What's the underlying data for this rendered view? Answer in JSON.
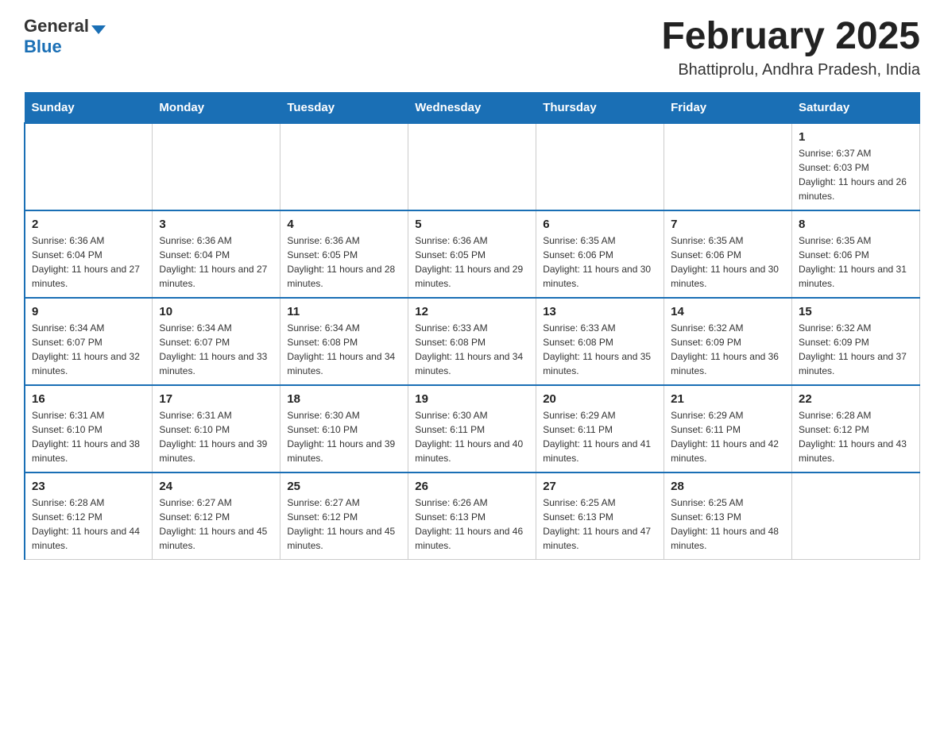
{
  "header": {
    "logo_general": "General",
    "logo_blue": "Blue",
    "month_title": "February 2025",
    "location": "Bhattiprolu, Andhra Pradesh, India"
  },
  "days_of_week": [
    "Sunday",
    "Monday",
    "Tuesday",
    "Wednesday",
    "Thursday",
    "Friday",
    "Saturday"
  ],
  "weeks": [
    [
      {
        "day": "",
        "info": ""
      },
      {
        "day": "",
        "info": ""
      },
      {
        "day": "",
        "info": ""
      },
      {
        "day": "",
        "info": ""
      },
      {
        "day": "",
        "info": ""
      },
      {
        "day": "",
        "info": ""
      },
      {
        "day": "1",
        "info": "Sunrise: 6:37 AM\nSunset: 6:03 PM\nDaylight: 11 hours and 26 minutes."
      }
    ],
    [
      {
        "day": "2",
        "info": "Sunrise: 6:36 AM\nSunset: 6:04 PM\nDaylight: 11 hours and 27 minutes."
      },
      {
        "day": "3",
        "info": "Sunrise: 6:36 AM\nSunset: 6:04 PM\nDaylight: 11 hours and 27 minutes."
      },
      {
        "day": "4",
        "info": "Sunrise: 6:36 AM\nSunset: 6:05 PM\nDaylight: 11 hours and 28 minutes."
      },
      {
        "day": "5",
        "info": "Sunrise: 6:36 AM\nSunset: 6:05 PM\nDaylight: 11 hours and 29 minutes."
      },
      {
        "day": "6",
        "info": "Sunrise: 6:35 AM\nSunset: 6:06 PM\nDaylight: 11 hours and 30 minutes."
      },
      {
        "day": "7",
        "info": "Sunrise: 6:35 AM\nSunset: 6:06 PM\nDaylight: 11 hours and 30 minutes."
      },
      {
        "day": "8",
        "info": "Sunrise: 6:35 AM\nSunset: 6:06 PM\nDaylight: 11 hours and 31 minutes."
      }
    ],
    [
      {
        "day": "9",
        "info": "Sunrise: 6:34 AM\nSunset: 6:07 PM\nDaylight: 11 hours and 32 minutes."
      },
      {
        "day": "10",
        "info": "Sunrise: 6:34 AM\nSunset: 6:07 PM\nDaylight: 11 hours and 33 minutes."
      },
      {
        "day": "11",
        "info": "Sunrise: 6:34 AM\nSunset: 6:08 PM\nDaylight: 11 hours and 34 minutes."
      },
      {
        "day": "12",
        "info": "Sunrise: 6:33 AM\nSunset: 6:08 PM\nDaylight: 11 hours and 34 minutes."
      },
      {
        "day": "13",
        "info": "Sunrise: 6:33 AM\nSunset: 6:08 PM\nDaylight: 11 hours and 35 minutes."
      },
      {
        "day": "14",
        "info": "Sunrise: 6:32 AM\nSunset: 6:09 PM\nDaylight: 11 hours and 36 minutes."
      },
      {
        "day": "15",
        "info": "Sunrise: 6:32 AM\nSunset: 6:09 PM\nDaylight: 11 hours and 37 minutes."
      }
    ],
    [
      {
        "day": "16",
        "info": "Sunrise: 6:31 AM\nSunset: 6:10 PM\nDaylight: 11 hours and 38 minutes."
      },
      {
        "day": "17",
        "info": "Sunrise: 6:31 AM\nSunset: 6:10 PM\nDaylight: 11 hours and 39 minutes."
      },
      {
        "day": "18",
        "info": "Sunrise: 6:30 AM\nSunset: 6:10 PM\nDaylight: 11 hours and 39 minutes."
      },
      {
        "day": "19",
        "info": "Sunrise: 6:30 AM\nSunset: 6:11 PM\nDaylight: 11 hours and 40 minutes."
      },
      {
        "day": "20",
        "info": "Sunrise: 6:29 AM\nSunset: 6:11 PM\nDaylight: 11 hours and 41 minutes."
      },
      {
        "day": "21",
        "info": "Sunrise: 6:29 AM\nSunset: 6:11 PM\nDaylight: 11 hours and 42 minutes."
      },
      {
        "day": "22",
        "info": "Sunrise: 6:28 AM\nSunset: 6:12 PM\nDaylight: 11 hours and 43 minutes."
      }
    ],
    [
      {
        "day": "23",
        "info": "Sunrise: 6:28 AM\nSunset: 6:12 PM\nDaylight: 11 hours and 44 minutes."
      },
      {
        "day": "24",
        "info": "Sunrise: 6:27 AM\nSunset: 6:12 PM\nDaylight: 11 hours and 45 minutes."
      },
      {
        "day": "25",
        "info": "Sunrise: 6:27 AM\nSunset: 6:12 PM\nDaylight: 11 hours and 45 minutes."
      },
      {
        "day": "26",
        "info": "Sunrise: 6:26 AM\nSunset: 6:13 PM\nDaylight: 11 hours and 46 minutes."
      },
      {
        "day": "27",
        "info": "Sunrise: 6:25 AM\nSunset: 6:13 PM\nDaylight: 11 hours and 47 minutes."
      },
      {
        "day": "28",
        "info": "Sunrise: 6:25 AM\nSunset: 6:13 PM\nDaylight: 11 hours and 48 minutes."
      },
      {
        "day": "",
        "info": ""
      }
    ]
  ]
}
